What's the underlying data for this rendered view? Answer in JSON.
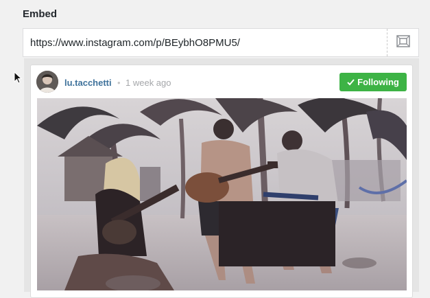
{
  "section": {
    "label": "Embed"
  },
  "embed_url": {
    "value": "https://www.instagram.com/p/BEybhO8PMU5/"
  },
  "post": {
    "username": "lu.tacchetti",
    "separator": "•",
    "timestamp": "1 week ago",
    "follow_label": "Following",
    "follow_color": "#3db345"
  }
}
